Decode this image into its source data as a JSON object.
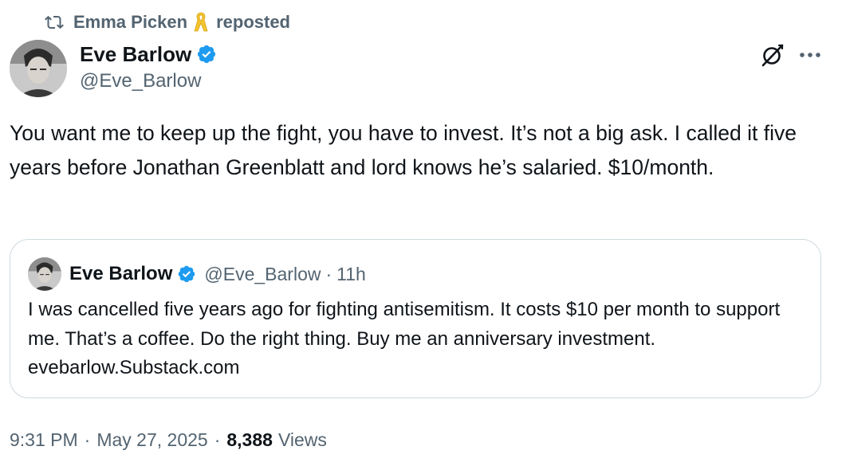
{
  "repost": {
    "reposter_name": "Emma Picken",
    "label": "reposted",
    "icon": "retweet-icon",
    "emoji_icon": "yellow-ribbon-icon"
  },
  "author": {
    "name": "Eve Barlow",
    "handle": "@Eve_Barlow",
    "verified": true
  },
  "tweet": {
    "text": "You want me to keep up the fight, you have to invest. It’s not a big ask. I called it five years before Jonathan Greenblatt and lord knows he’s salaried. $10/month."
  },
  "quote": {
    "name": "Eve Barlow",
    "handle": "@Eve_Barlow",
    "age": "11h",
    "separator": "·",
    "text": "I was cancelled five years ago for fighting antisemitism. It costs $10 per month to support me. That’s a coffee. Do the right thing. Buy me an anniversary investment. evebarlow.Substack.com"
  },
  "footer": {
    "time": "9:31 PM",
    "date": "May 27, 2025",
    "separator": "·",
    "views_count": "8,388",
    "views_label": "Views"
  },
  "colors": {
    "text_primary": "#0f1419",
    "text_secondary": "#536471",
    "verified_blue": "#1d9bf0",
    "ribbon_yellow": "#f4c430",
    "border": "#cfd9de"
  }
}
